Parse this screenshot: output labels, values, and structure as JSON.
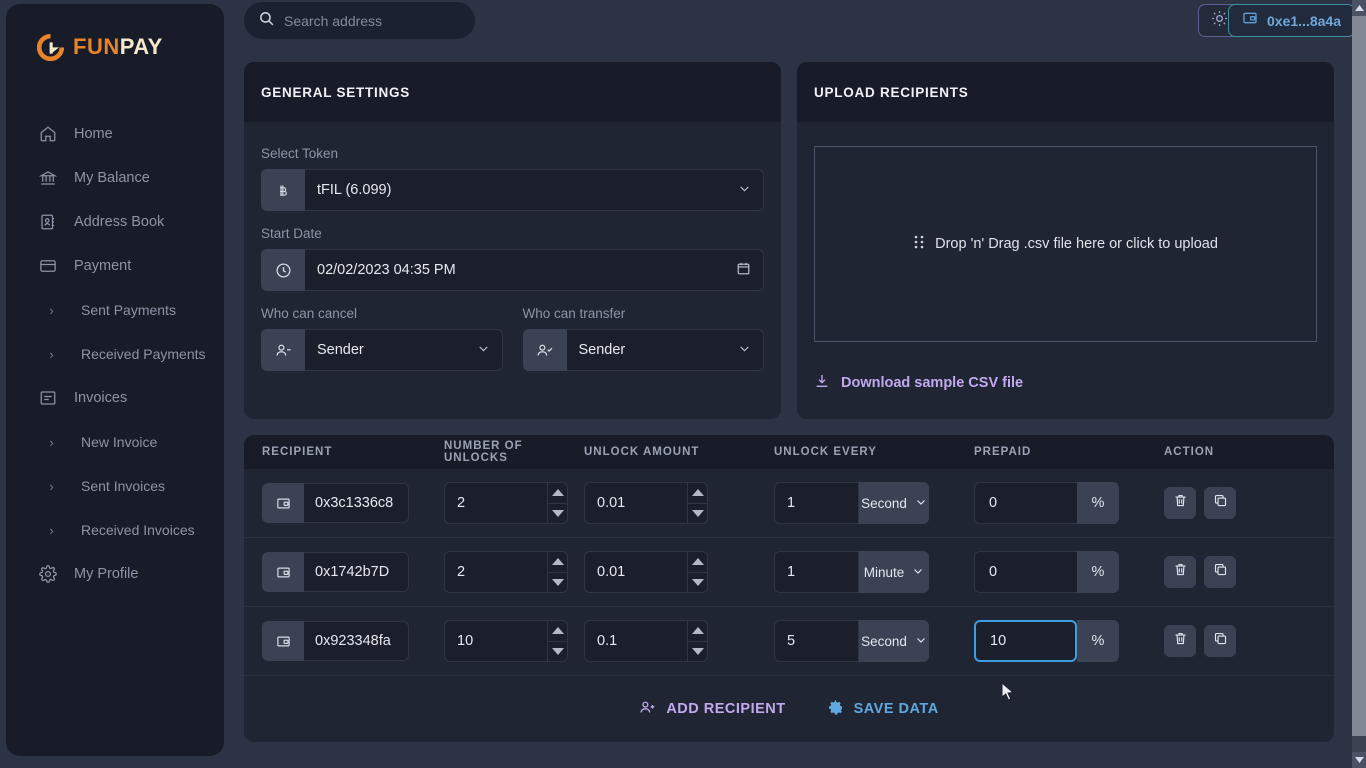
{
  "brand": {
    "fun": "FUN",
    "pay": "PAY",
    "logo_mark_icon": "funpay-logo-icon",
    "orange": "#e8832a",
    "cream": "#f4e9cd"
  },
  "sidebar": {
    "items": [
      {
        "label": "Home",
        "icon": "home-icon",
        "sub": false
      },
      {
        "label": "My Balance",
        "icon": "bank-icon",
        "sub": false
      },
      {
        "label": "Address Book",
        "icon": "address-book-icon",
        "sub": false
      },
      {
        "label": "Payment",
        "icon": "card-icon",
        "sub": false
      },
      {
        "label": "Sent Payments",
        "icon": "chevron-right-icon",
        "sub": true
      },
      {
        "label": "Received Payments",
        "icon": "chevron-right-icon",
        "sub": true
      },
      {
        "label": "Invoices",
        "icon": "invoice-icon",
        "sub": false
      },
      {
        "label": "New Invoice",
        "icon": "chevron-right-icon",
        "sub": true
      },
      {
        "label": "Sent Invoices",
        "icon": "chevron-right-icon",
        "sub": true
      },
      {
        "label": "Received Invoices",
        "icon": "chevron-right-icon",
        "sub": true
      },
      {
        "label": "My Profile",
        "icon": "gear-icon",
        "sub": false
      }
    ]
  },
  "topbar": {
    "search": {
      "placeholder": "Search address",
      "value": "",
      "icon": "search-icon"
    },
    "theme_toggle": {
      "icon": "sun-icon",
      "border_color": "#5f5f9a"
    },
    "wallet": {
      "label": "0xe1...8a4a",
      "icon": "wallet-icon",
      "border_color": "#3e8f9e",
      "text_color": "#6fa8d8"
    }
  },
  "general_settings": {
    "title": "GENERAL SETTINGS",
    "token": {
      "label": "Select Token",
      "value": "tFIL (6.099)",
      "prefix_icon": "bitcoin-icon",
      "caret_icon": "chevron-down-icon"
    },
    "start_date": {
      "label": "Start Date",
      "value": "02/02/2023 04:35 PM",
      "prefix_icon": "clock-icon",
      "suffix_icon": "calendar-icon"
    },
    "who_can_cancel": {
      "label": "Who can cancel",
      "value": "Sender",
      "prefix_icon": "user-minus-icon",
      "caret_icon": "chevron-down-icon"
    },
    "who_can_transfer": {
      "label": "Who can transfer",
      "value": "Sender",
      "prefix_icon": "user-check-icon",
      "caret_icon": "chevron-down-icon"
    }
  },
  "upload_recipients": {
    "title": "UPLOAD RECIPIENTS",
    "dropzone": {
      "text": "Drop 'n' Drag .csv file here or click to upload",
      "icon": "drag-dots-icon"
    },
    "download_link": {
      "label": "Download sample CSV file",
      "icon": "download-icon",
      "color": "#c3a8ef"
    }
  },
  "table": {
    "headers": [
      "RECIPIENT",
      "NUMBER OF UNLOCKS",
      "UNLOCK AMOUNT",
      "UNLOCK EVERY",
      "PREPAID",
      "ACTION"
    ],
    "rows": [
      {
        "recipient": "0x3c1336c8",
        "number_of_unlocks": "2",
        "unlock_amount": "0.01",
        "unlock_every": "1",
        "unlock_unit": "Second",
        "prepaid": "0",
        "prepaid_focused": false
      },
      {
        "recipient": "0x1742b7D",
        "number_of_unlocks": "2",
        "unlock_amount": "0.01",
        "unlock_every": "1",
        "unlock_unit": "Minute",
        "prepaid": "0",
        "prepaid_focused": false
      },
      {
        "recipient": "0x923348fa",
        "number_of_unlocks": "10",
        "unlock_amount": "0.1",
        "unlock_every": "5",
        "unlock_unit": "Second",
        "prepaid": "10",
        "prepaid_focused": true
      }
    ],
    "row_icons": {
      "recipient_prefix": "wallet-icon",
      "spinner_up": "triangle-up-icon",
      "spinner_down": "triangle-down-icon",
      "unit_caret": "chevron-down-icon",
      "percent_sign": "%",
      "delete": "trash-icon",
      "duplicate": "copy-icon"
    },
    "footer": {
      "add_recipient": {
        "label": "ADD RECIPIENT",
        "icon": "user-plus-icon",
        "color": "#c3a8ef"
      },
      "save_data": {
        "label": "SAVE DATA",
        "icon": "gear-icon",
        "color": "#5fa8e0"
      }
    }
  }
}
